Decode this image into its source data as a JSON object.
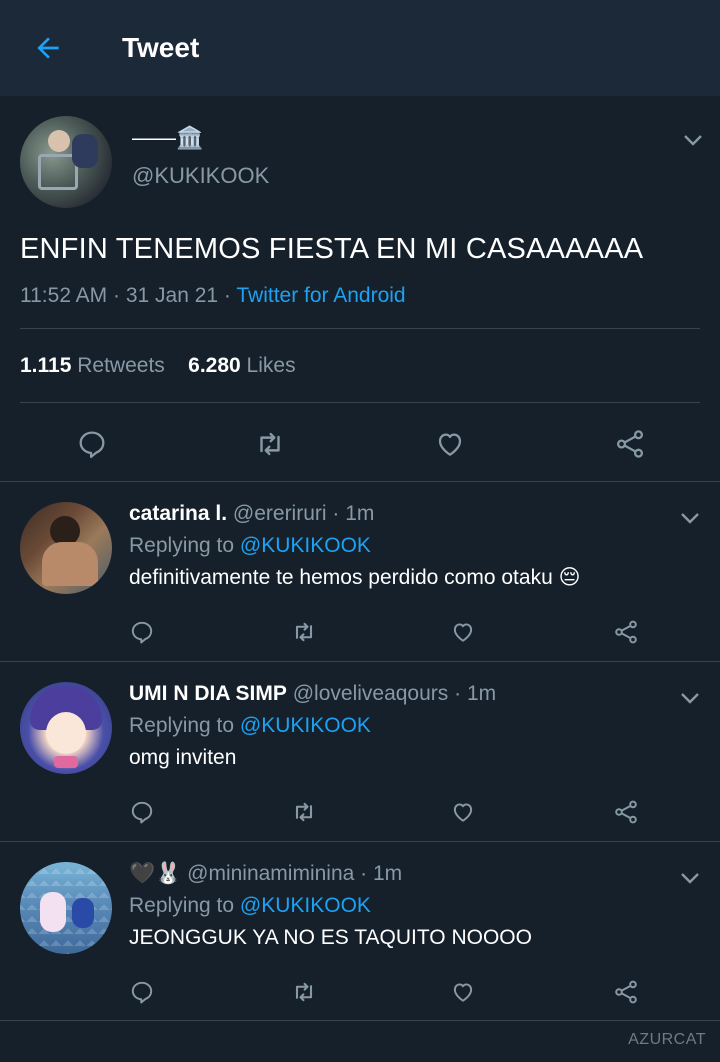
{
  "header": {
    "title": "Tweet",
    "back_icon": "arrow-left-icon",
    "accent": "#1da1f2"
  },
  "tweet": {
    "name": "——🏛️",
    "handle": "@KUKIKOOK",
    "text": "ENFIN TENEMOS FIESTA EN MI CASAAAAAA",
    "time": "11:52 AM · 31 Jan 21 · ",
    "source": "Twitter for Android",
    "retweets_count": "1.115",
    "retweets_label": "Retweets",
    "likes_count": "6.280",
    "likes_label": "Likes"
  },
  "replies": [
    {
      "name": "catarina l.",
      "meta": " @ereriruri · 1m",
      "replying_label": "Replying to ",
      "replying_handle": "@KUKIKOOK",
      "text": "definitivamente te hemos perdido como otaku 😔"
    },
    {
      "name": "UMI N DIA SIMP",
      "meta": " @loveliveaqours · 1m",
      "replying_label": "Replying to ",
      "replying_handle": "@KUKIKOOK",
      "text": "omg inviten"
    },
    {
      "name": "🖤🐰",
      "meta": " @mininamiminina · 1m",
      "replying_label": "Replying to ",
      "replying_handle": "@KUKIKOOK",
      "text": "JEONGGUK YA NO ES TAQUITO NOOOO"
    }
  ],
  "icons": [
    "arrow-left-icon",
    "chevron-down-icon",
    "reply-icon",
    "retweet-icon",
    "like-icon",
    "share-icon"
  ],
  "colors": {
    "background": "#15202b",
    "header": "#1c2938",
    "secondary_text": "#8899a6",
    "link": "#1da1f2",
    "divider": "#38444d"
  },
  "watermark": "AZURCAT"
}
